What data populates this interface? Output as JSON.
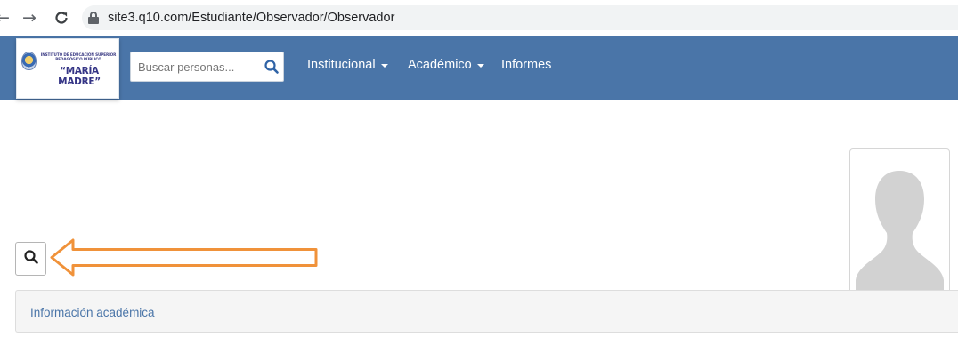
{
  "browser": {
    "url": "site3.q10.com/Estudiante/Observador/Observador",
    "back_icon": "back-arrow-icon",
    "forward_icon": "forward-arrow-icon",
    "reload_icon": "reload-icon"
  },
  "header": {
    "logo": {
      "line_small": "INSTITUTO DE EDUCACIÓN SUPERIOR PEDAGÓGICO PÚBLICO",
      "line_big": "“MARÍA MADRE”"
    },
    "search": {
      "placeholder": "Buscar personas...",
      "icon": "search-icon"
    },
    "menu": [
      {
        "label": "Institucional",
        "has_dropdown": true
      },
      {
        "label": "Académico",
        "has_dropdown": true
      },
      {
        "label": "Informes",
        "has_dropdown": false
      }
    ],
    "colors": {
      "bar": "#4a75a8",
      "text": "#ffffff"
    }
  },
  "main": {
    "search_toggle_icon": "search-icon",
    "annotation": {
      "type": "arrow",
      "color": "#f0923a",
      "points_to": "search-toggle"
    },
    "profile_photo_icon": "avatar-silhouette-icon",
    "panel_title": "Información académica"
  }
}
